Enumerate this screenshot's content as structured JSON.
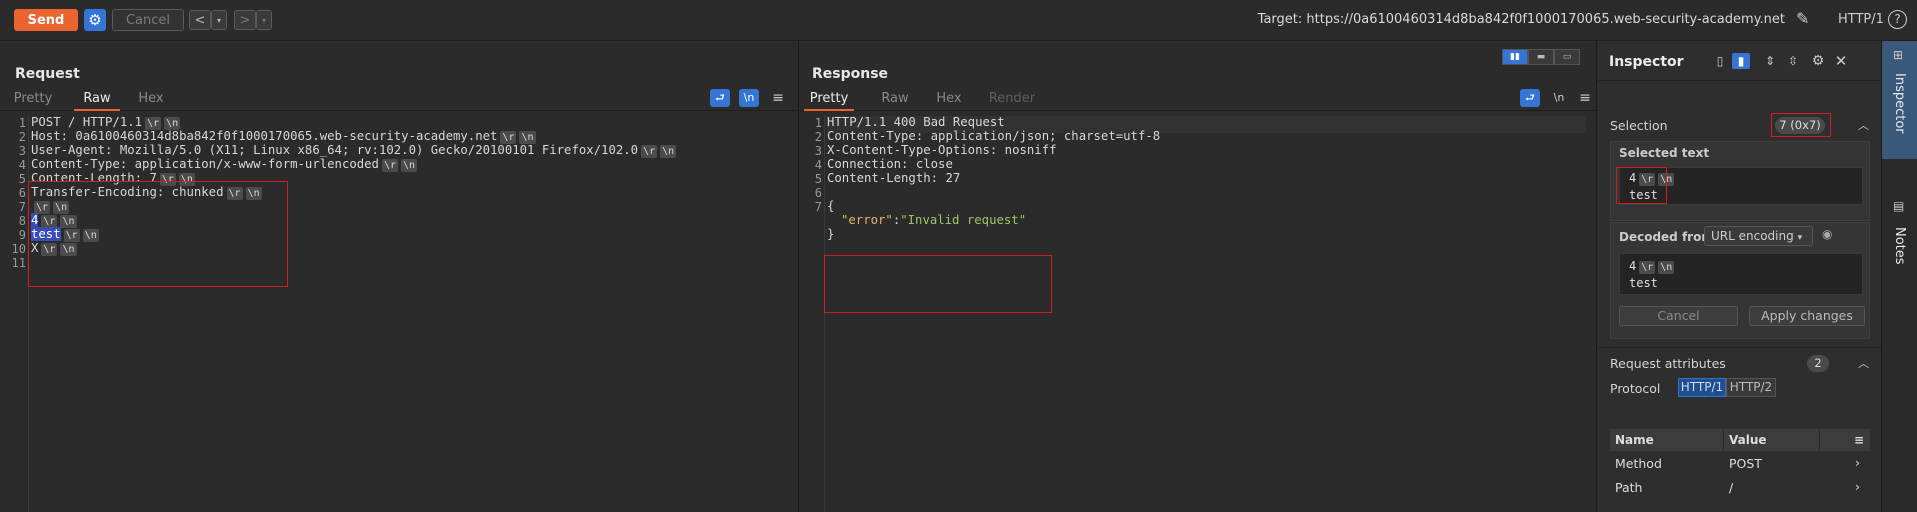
{
  "toolbar": {
    "send_label": "Send",
    "cancel_label": "Cancel",
    "prev_label": "<",
    "next_label": ">",
    "dropdown_glyph": "▾",
    "target_label": "Target: https://0a6100460314d8ba842f0f1000170065.web-security-academy.net",
    "http_version": "HTTP/1",
    "help_label": "?"
  },
  "request": {
    "title": "Request",
    "tabs": [
      "Pretty",
      "Raw",
      "Hex"
    ],
    "active_tab": "Raw",
    "line_numbers": [
      "1",
      "2",
      "3",
      "4",
      "5",
      "6",
      "7",
      "8",
      "9",
      "10",
      "11"
    ],
    "lines": [
      {
        "text": "POST / HTTP/1.1",
        "crlf": true
      },
      {
        "text": "Host: 0a6100460314d8ba842f0f1000170065.web-security-academy.net",
        "crlf": true
      },
      {
        "text": "User-Agent: Mozilla/5.0 (X11; Linux x86_64; rv:102.0) Gecko/20100101 Firefox/102.0",
        "crlf": true
      },
      {
        "text": "Content-Type: application/x-www-form-urlencoded",
        "crlf": true
      },
      {
        "text": "Content-Length: 7",
        "crlf": true
      },
      {
        "text": "Transfer-Encoding: chunked",
        "crlf": true
      },
      {
        "text": "",
        "crlf": true
      },
      {
        "text": "4",
        "crlf": true
      },
      {
        "text": "test",
        "crlf": true
      },
      {
        "text": "X",
        "crlf": true
      },
      {
        "text": "",
        "crlf": false
      }
    ]
  },
  "response": {
    "title": "Response",
    "tabs": [
      "Pretty",
      "Raw",
      "Hex",
      "Render"
    ],
    "active_tab": "Pretty",
    "line_numbers": [
      "1",
      "2",
      "3",
      "4",
      "5",
      "6",
      "7"
    ],
    "lines": [
      "HTTP/1.1 400 Bad Request",
      "Content-Type: application/json; charset=utf-8",
      "X-Content-Type-Options: nosniff",
      "Connection: close",
      "Content-Length: 27",
      "",
      "{"
    ],
    "json_key": "\"error\"",
    "json_colon": ":",
    "json_value": "\"Invalid request\"",
    "json_close": "}"
  },
  "crlf_glyphs": [
    "\\r",
    "\\n"
  ],
  "inspector": {
    "title": "Inspector",
    "selection_label": "Selection",
    "selection_count": "7 (0x7)",
    "selected_text_label": "Selected text",
    "selected_text_line1": "4",
    "selected_text_line2": "test",
    "decoded_from_label": "Decoded from:",
    "decoding": "URL encoding",
    "decoded_line1": "4",
    "decoded_line2": "test",
    "cancel_label": "Cancel",
    "apply_label": "Apply changes",
    "request_attributes_label": "Request attributes",
    "request_attributes_count": "2",
    "protocol_label": "Protocol",
    "protocols": [
      "HTTP/1",
      "HTTP/2"
    ],
    "active_protocol": "HTTP/1",
    "table_headers": [
      "Name",
      "Value"
    ],
    "rows": [
      {
        "name": "Method",
        "value": "POST"
      },
      {
        "name": "Path",
        "value": "/"
      }
    ]
  },
  "rail": {
    "inspector_label": "Inspector",
    "notes_label": "Notes"
  },
  "colors": {
    "send": "#e9642f",
    "accent_blue": "#3475d6",
    "highlight_red": "#d12020",
    "json_string": "#9ac56a"
  }
}
